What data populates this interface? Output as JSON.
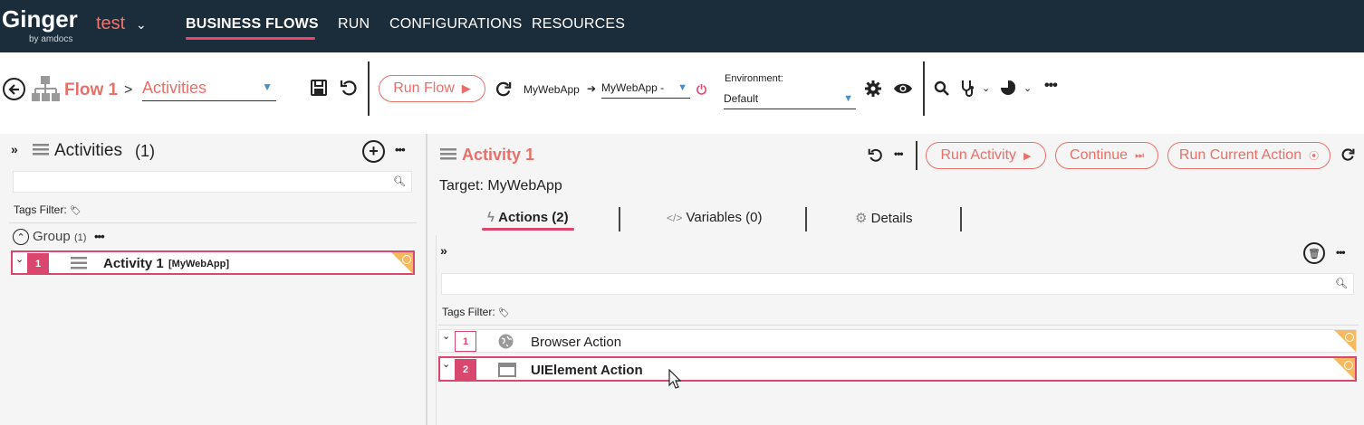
{
  "brand": {
    "name": "Ginger",
    "sub": "by amdocs",
    "solution": "test"
  },
  "nav": [
    {
      "label": "BUSINESS FLOWS",
      "active": true
    },
    {
      "label": "RUN"
    },
    {
      "label": "CONFIGURATIONS"
    },
    {
      "label": "RESOURCES"
    }
  ],
  "toolbar": {
    "flow_name": "Flow 1",
    "breadcrumb_sep": ">",
    "view_select": "Activities",
    "run_flow_label": "Run Flow",
    "app_from": "MyWebApp",
    "app_to": "MyWebApp -",
    "env_label": "Environment:",
    "env_value": "Default"
  },
  "left": {
    "title": "Activities",
    "count": "(1)",
    "tags_label": "Tags Filter:",
    "group_name": "Group",
    "group_count": "(1)",
    "activities": [
      {
        "num": "1",
        "name": "Activity 1",
        "target": "[MyWebApp]"
      }
    ]
  },
  "right": {
    "activity_title": "Activity 1",
    "target": "Target: MyWebApp",
    "buttons": {
      "run_activity": "Run Activity",
      "continue": "Continue",
      "run_current": "Run Current Action"
    },
    "tabs": [
      {
        "label": "Actions (2)",
        "active": true
      },
      {
        "label": "Variables (0)"
      },
      {
        "label": "Details"
      }
    ],
    "tags_label": "Tags Filter:",
    "actions": [
      {
        "num": "1",
        "name": "Browser Action"
      },
      {
        "num": "2",
        "name": "UIElement Action"
      }
    ]
  },
  "colors": {
    "accent": "#e8706a",
    "pink": "#d9476e",
    "nav_bg": "#1b2d3a",
    "corner": "#f6b95d"
  }
}
